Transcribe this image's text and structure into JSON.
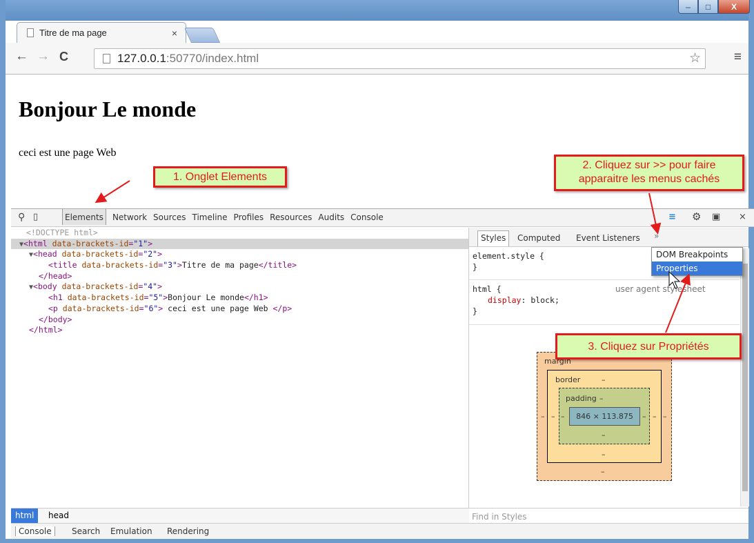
{
  "browser": {
    "tab_title": "Titre de ma page",
    "tab_close": "×",
    "url_host": "127.0.0.1",
    "url_path": ":50770/index.html",
    "back": "←",
    "forward": "→",
    "reload": "C",
    "menu": "≡",
    "star": "☆"
  },
  "window_controls": {
    "minimize": "–",
    "maximize": "□",
    "close": "X"
  },
  "page": {
    "heading": "Bonjour Le monde",
    "paragraph": "ceci est une page Web"
  },
  "callouts": {
    "c1": "1. Onglet Elements",
    "c2_line1": "2. Cliquez sur >> pour faire",
    "c2_line2": "apparaitre les menus cachés",
    "c3": "3. Cliquez sur Propriétés"
  },
  "devtools": {
    "tabs": [
      "Elements",
      "Network",
      "Sources",
      "Timeline",
      "Profiles",
      "Resources",
      "Audits",
      "Console"
    ],
    "active_tab": "Elements",
    "icons": {
      "search": "search-icon",
      "device": "device-icon",
      "console_toggle": "console-drawer-icon",
      "settings": "gear-icon",
      "dock": "dock-icon",
      "close": "close-icon"
    },
    "close_glyph": "×",
    "tree": {
      "doctype": "<!DOCTYPE html>",
      "html_open_tag": "<html",
      "attr_name": "data-brackets-id",
      "eq": "=",
      "gt": ">",
      "html_id": "\"1\"",
      "head_open_tag": "<head",
      "head_id": "\"2\"",
      "title_open_tag": "<title",
      "title_id": "\"3\"",
      "title_text": "Titre de ma page",
      "title_close": "</title>",
      "head_close": "</head>",
      "body_open_tag": "<body",
      "body_id": "\"4\"",
      "h1_open_tag": "<h1",
      "h1_id": "\"5\"",
      "h1_text": "Bonjour Le monde",
      "h1_close": "</h1>",
      "p_open_tag": "<p",
      "p_id": "\"6\"",
      "p_text": " ceci est une page Web ",
      "p_close": "</p>",
      "body_close": "</body>",
      "html_close": "</html>"
    },
    "breadcrumb": [
      "html",
      "head"
    ],
    "drawer_tabs": [
      "Console",
      "Search",
      "Emulation",
      "Rendering"
    ],
    "sidebar": {
      "tabs": [
        "Styles",
        "Computed",
        "Event Listeners"
      ],
      "more": "»",
      "rule1": "element.style {\n}",
      "rule2_selector": "html {",
      "rule2_prop": "display",
      "rule2_value": "block;",
      "rule2_close": "}",
      "rule2_origin": "user agent stylesheet",
      "find_placeholder": "Find in Styles"
    },
    "box_model": {
      "margin_label": "margin",
      "border_label": "border",
      "padding_label": "padding",
      "dash": "–",
      "content": "846 × 113.875"
    },
    "dropdown": [
      "DOM Breakpoints",
      "Properties"
    ],
    "dropdown_highlighted": "Properties"
  },
  "colors": {
    "callout_border": "#e31b1b",
    "callout_bg": "#d9fbb1",
    "selection": "#3879d9"
  }
}
